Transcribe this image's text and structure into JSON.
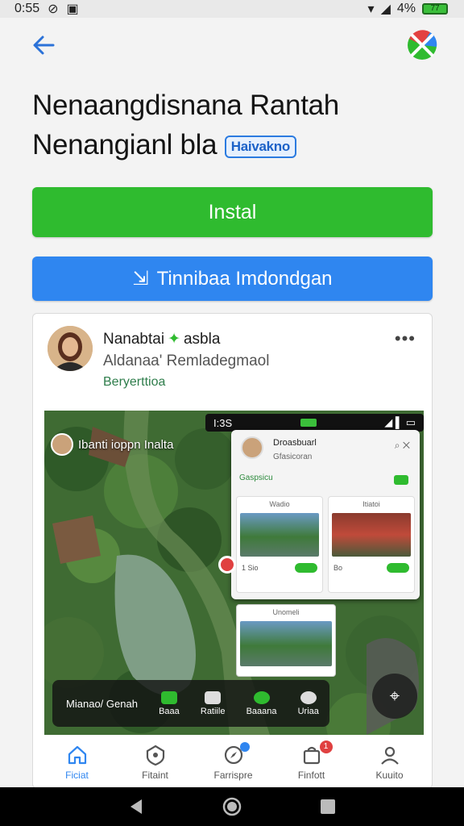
{
  "status_bar": {
    "time": "0:55",
    "battery": "77",
    "battery_pct": "4%"
  },
  "app_title": {
    "line1": "Nenaangdisnana Rantah",
    "line2": "Nenangianl bla",
    "badge": "Haivakno"
  },
  "buttons": {
    "install": "Instal",
    "share": "Tinnibaa Imdondgan"
  },
  "card": {
    "name": "Nanabtai",
    "name_suffix": "asbla",
    "subtitle": "Aldanaa' Remladegmaol",
    "tag": "Beryerttioa",
    "more": "•••",
    "screenshot": {
      "overlay_label": "Ibanti ioppn Inalta",
      "mini_status_time": "I:3S",
      "popup": {
        "name": "Droasbuarl",
        "sub": "Gfasicoran",
        "green": "Gaspsicu",
        "tile_a_caption": "Wadio",
        "tile_b_caption": "Itiatoi",
        "tile_a_count": "1 Sio",
        "tile_b_count": "Bo",
        "tile2_caption": "Unomeli"
      },
      "bottom_bar": {
        "first": "Mianao/ Genah",
        "items": [
          "Baaa",
          "Ratiile",
          "Baaana",
          "Uriaa"
        ]
      }
    }
  },
  "bottom_nav": [
    {
      "label": "Ficiat",
      "icon": "home-icon",
      "active": true
    },
    {
      "label": "Fitaint",
      "icon": "shield-icon",
      "active": false
    },
    {
      "label": "Farrispre",
      "icon": "compass-icon",
      "active": false
    },
    {
      "label": "Finfott",
      "icon": "bag-icon",
      "active": false,
      "badge": "1"
    },
    {
      "label": "Kuuito",
      "icon": "profile-icon",
      "active": false
    }
  ],
  "colors": {
    "install_green": "#2fbb2f",
    "share_blue": "#2f86f0",
    "badge_blue": "#2b7be0"
  }
}
